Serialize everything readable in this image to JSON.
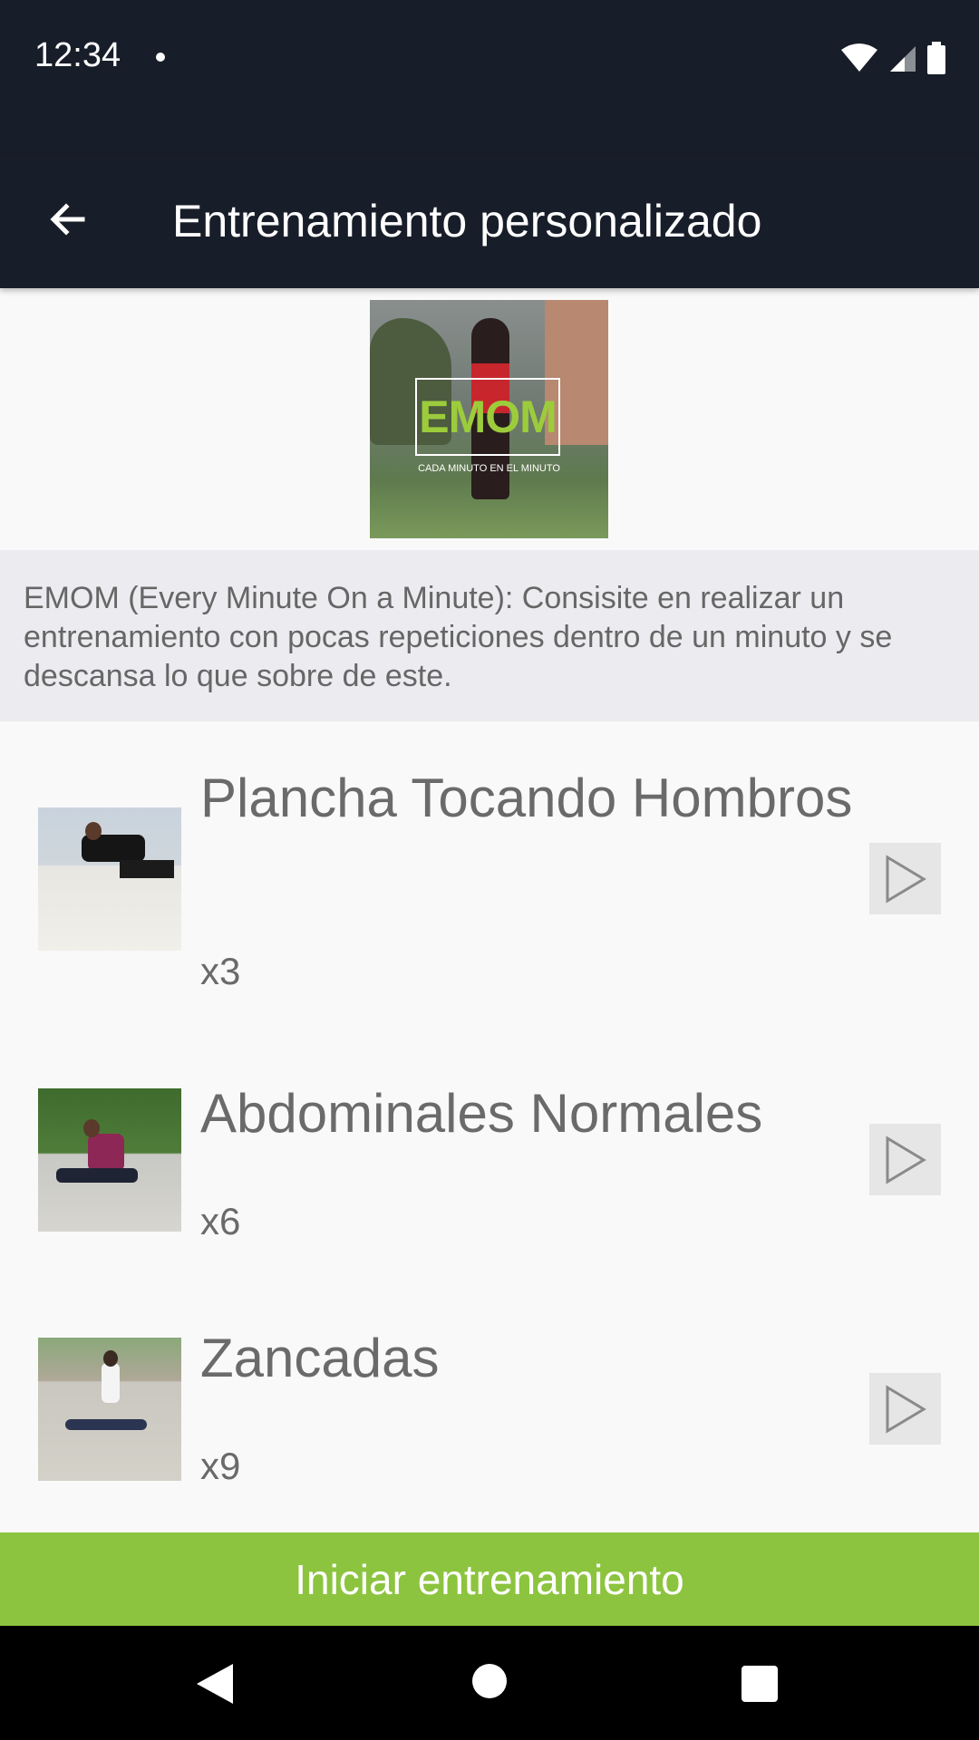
{
  "status": {
    "time": "12:34",
    "icons": [
      "wifi-icon",
      "signal-icon",
      "battery-icon"
    ]
  },
  "app_bar": {
    "title": "Entrenamiento personalizado",
    "back_icon": "arrow-left-icon"
  },
  "hero": {
    "title": "EMOM",
    "subtitle": "CADA MINUTO EN EL MINUTO"
  },
  "description": "EMOM (Every Minute On a Minute): Consisite en realizar un entrenamiento con pocas repeticiones dentro de un minuto y se descansa lo que sobre de este.",
  "exercises": [
    {
      "name": "Plancha Tocando Hombros",
      "reps": "x3",
      "icon": "play-icon"
    },
    {
      "name": "Abdominales Normales",
      "reps": "x6",
      "icon": "play-icon"
    },
    {
      "name": "Zancadas",
      "reps": "x9",
      "icon": "play-icon"
    }
  ],
  "start_button": "Iniciar entrenamiento",
  "nav": [
    "nav-back-icon",
    "nav-home-icon",
    "nav-recents-icon"
  ],
  "colors": {
    "bar": "#181e29",
    "accent": "#8cc43f",
    "description_bg": "#ececf0",
    "text": "#6a6a6a"
  }
}
